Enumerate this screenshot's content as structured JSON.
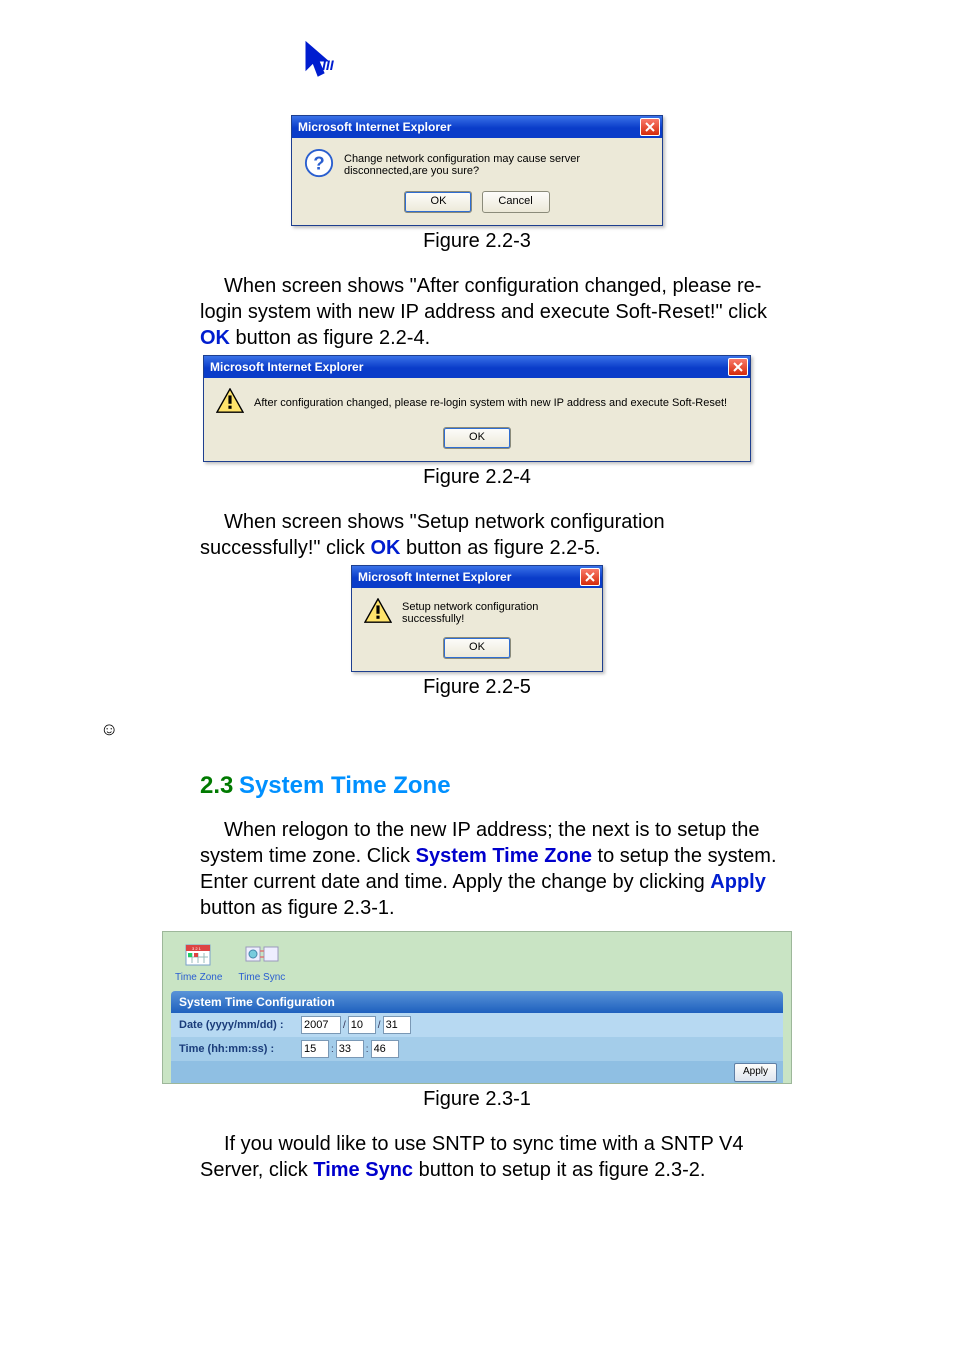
{
  "logo_alt": "pointer-cursor-icon",
  "dialog1": {
    "title": "Microsoft Internet Explorer",
    "message": "Change network configuration may cause server disconnected,are you sure?",
    "ok": "OK",
    "cancel": "Cancel"
  },
  "caption1": "Figure 2.2-3",
  "para1_a": "When screen shows \"After configuration changed, please re-login system with new IP address and execute Soft-Reset!\" click ",
  "para1_ok": "OK",
  "para1_b": " button as figure 2.2-4.",
  "dialog2": {
    "title": "Microsoft Internet Explorer",
    "message": "After configuration changed, please re-login system with new IP address and execute Soft-Reset!",
    "ok": "OK"
  },
  "caption2": "Figure 2.2-4",
  "para2_a": "When screen shows \"Setup network configuration successfully!\" click ",
  "para2_ok": "OK",
  "para2_b": " button as figure 2.2-5.",
  "dialog3": {
    "title": "Microsoft Internet Explorer",
    "message": "Setup network configuration successfully!",
    "ok": "OK"
  },
  "caption3": "Figure 2.2-5",
  "smiley": "☺",
  "sec_num": "2.3",
  "sec_title": "System Time Zone",
  "para3_a": "When relogon to the new IP address; the next is to setup the system time zone. Click ",
  "para3_link": "System Time Zone",
  "para3_b": " to setup the system. Enter current date and time. Apply the change by clicking ",
  "para3_apply": "Apply",
  "para3_c": " button as figure 2.3-1.",
  "tabs": {
    "time_zone": "Time Zone",
    "time_sync": "Time Sync"
  },
  "conf": {
    "header": "System Time Configuration",
    "date_label": "Date (yyyy/mm/dd) :",
    "date_y": "2007",
    "date_m": "10",
    "date_d": "31",
    "time_label": "Time (hh:mm:ss) :",
    "time_h": "15",
    "time_m": "33",
    "time_s": "46",
    "apply": "Apply"
  },
  "caption4": "Figure 2.3-1",
  "para4_a": "If you would like to use SNTP to sync time with a SNTP V4 Server, click ",
  "para4_link": "Time Sync",
  "para4_b": " button to setup it as figure 2.3-2."
}
